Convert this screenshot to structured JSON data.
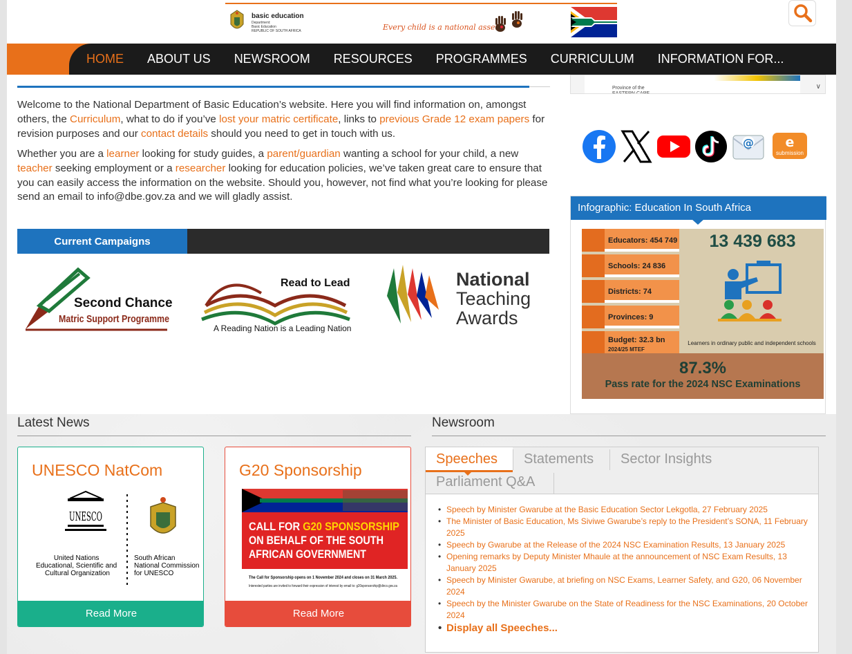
{
  "header": {
    "dbe_name": "basic education",
    "dbe_sub": "Department:\nBasic Education\nREPUBLIC OF SOUTH AFRICA",
    "tagline": "Every child is a national asset...",
    "search_icon": "search-icon"
  },
  "nav": {
    "items": [
      "HOME",
      "ABOUT US",
      "NEWSROOM",
      "RESOURCES",
      "PROGRAMMES",
      "CURRICULUM",
      "INFORMATION FOR..."
    ],
    "active_index": 0,
    "accent": "#e8701a"
  },
  "intro": {
    "p1_a": "Welcome to the National Department of Basic Education’s website. Here you will find information on, amongst others, the ",
    "p1_link1": "Curriculum",
    "p1_b": ", what to do if you’ve ",
    "p1_link2": "lost your matric certificate",
    "p1_c": ", links to ",
    "p1_link3": "previous Grade 12 exam papers",
    "p1_d": " for revision purposes and our ",
    "p1_link4": "contact details",
    "p1_e": " should you need to get in touch with us.",
    "p2_a": "Whether you are a ",
    "p2_link1": "learner",
    "p2_b": " looking for study guides, a ",
    "p2_link2": "parent/guardian",
    "p2_c": " wanting a school for your child, a new ",
    "p2_link3": "teacher",
    "p2_d": " seeking employment or a ",
    "p2_link4": "researcher",
    "p2_e": " looking for education policies, we’ve taken great care to ensure that you can easily access the information on the website. Should you, however, not find what you’re looking for please send an email to info@dbe.gov.za and we will gladly assist."
  },
  "campaigns": {
    "title": "Current Campaigns",
    "second_chance_line1": "Second Chance",
    "second_chance_line2": "Matric Support Programme",
    "read_to_lead": "Read to Lead",
    "read_to_lead_sub": "A Reading Nation is a Leading Nation",
    "nta_line1": "National",
    "nta_line2": "Teaching",
    "nta_line3": "Awards"
  },
  "right": {
    "province_label": "Province of the\nEASTERN CAPE",
    "social": [
      "facebook-icon",
      "x-icon",
      "youtube-icon",
      "tiktok-icon",
      "email-icon",
      "e-submission-icon"
    ],
    "esub_letter": "e",
    "esub_label": "submission"
  },
  "infographic": {
    "title": "Infographic: Education In South Africa",
    "stats": [
      "Educators: 454 749",
      "Schools: 24 836",
      "Districts: 74",
      "Provinces: 9",
      "Budget: 32.3 bn"
    ],
    "budget_sub": "2024/25 MTEF",
    "total_learners": "13 439 683",
    "learners_caption": "Learners in ordinary public and independent schools",
    "pass_rate": "87.3%",
    "pass_text": "Pass rate for the 2024 NSC Examinations"
  },
  "latest_news": {
    "title": "Latest News",
    "cards": [
      {
        "title": "UNESCO NatCom",
        "read_more": "Read More",
        "color": "#1aaf8b",
        "unesco_left": "United Nations\nEducational, Scientific and\nCultural Organization",
        "unesco_right": "South African\nNational Commission\nfor UNESCO",
        "unesco_word": "UNESCO"
      },
      {
        "title": "G20 Sponsorship",
        "read_more": "Read More",
        "color": "#e74c3c",
        "g20_l1_a": "CALL FOR ",
        "g20_l1_b": "G20 SPONSORSHIP",
        "g20_l2": "ON BEHALF OF THE SOUTH",
        "g20_l3": "AFRICAN GOVERNMENT",
        "g20_small1": "The Call for Sponsorship opens on 1 November 2024 and closes on 31 March 2025.",
        "g20_small2": "Interested parties are invited to forward their expression of interest by email to: g20sponsorship@dirco.gov.za"
      }
    ]
  },
  "newsroom": {
    "title": "Newsroom",
    "tabs": [
      "Speeches",
      "Statements",
      "Sector Insights",
      "Parliament Q&A"
    ],
    "active_tab": 0,
    "speeches": [
      "Speech by Minister Gwarube at the Basic Education Sector Lekgotla, 27 February 2025",
      "The Minister of Basic Education, Ms Siviwe Gwarube’s reply to the President’s SONA, 11 February 2025",
      "Speech by Gwarube at the Release of the 2024 NSC Examination Results, 13 January 2025",
      "Opening remarks by Deputy Minister Mhaule at the announcement of NSC Exam Results, 13 January 2025",
      "Speech by Minister Gwarube, at briefing on NSC Exams, Learner Safety, and G20, 06 November 2024",
      "Speech by the Minister Gwarube on the State of Readiness for the NSC Examinations, 20 October 2024"
    ],
    "display_all": "Display all Speeches..."
  }
}
